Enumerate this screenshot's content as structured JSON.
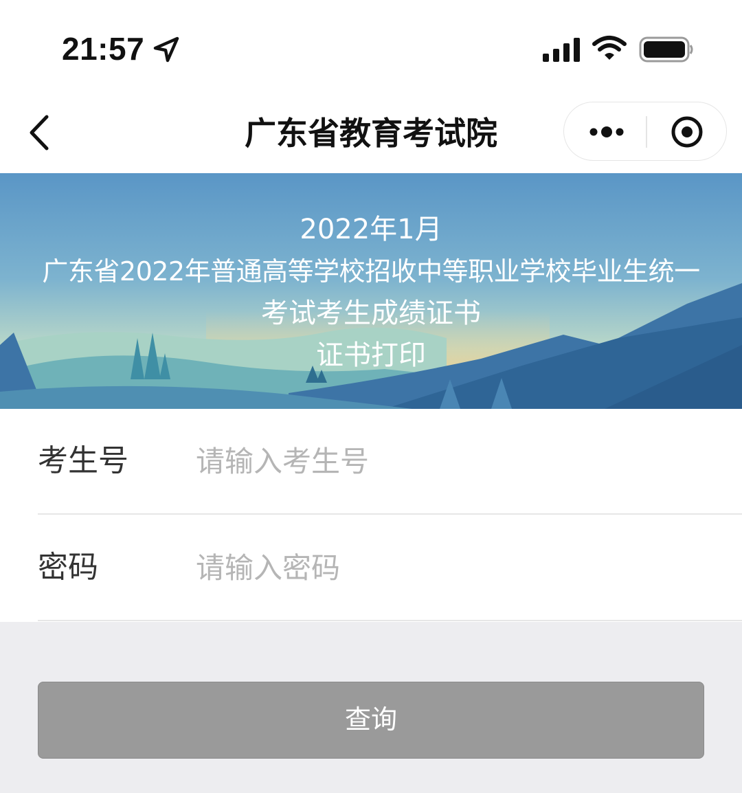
{
  "status_bar": {
    "time": "21:57",
    "icons": [
      "location-arrow-icon",
      "cellular-signal-icon",
      "wifi-icon",
      "battery-icon"
    ]
  },
  "nav": {
    "title": "广东省教育考试院",
    "back_icon": "chevron-left-icon",
    "more_icon": "more-dots-icon",
    "close_icon": "target-circle-icon"
  },
  "banner": {
    "line1": "2022年1月",
    "line2": "广东省2022年普通高等学校招收中等职业学校毕业生统一",
    "line3": "考试考生成绩证书",
    "line4": "证书打印"
  },
  "form": {
    "candidate_no": {
      "label": "考生号",
      "placeholder": "请输入考生号",
      "value": ""
    },
    "password": {
      "label": "密码",
      "placeholder": "请输入密码",
      "value": ""
    }
  },
  "query_button": {
    "label": "查询"
  },
  "colors": {
    "page_background": "#ededf0",
    "button_background": "#9a9a9a",
    "banner_sky_top": "#5c99c8",
    "banner_mountain": "#34679a"
  }
}
